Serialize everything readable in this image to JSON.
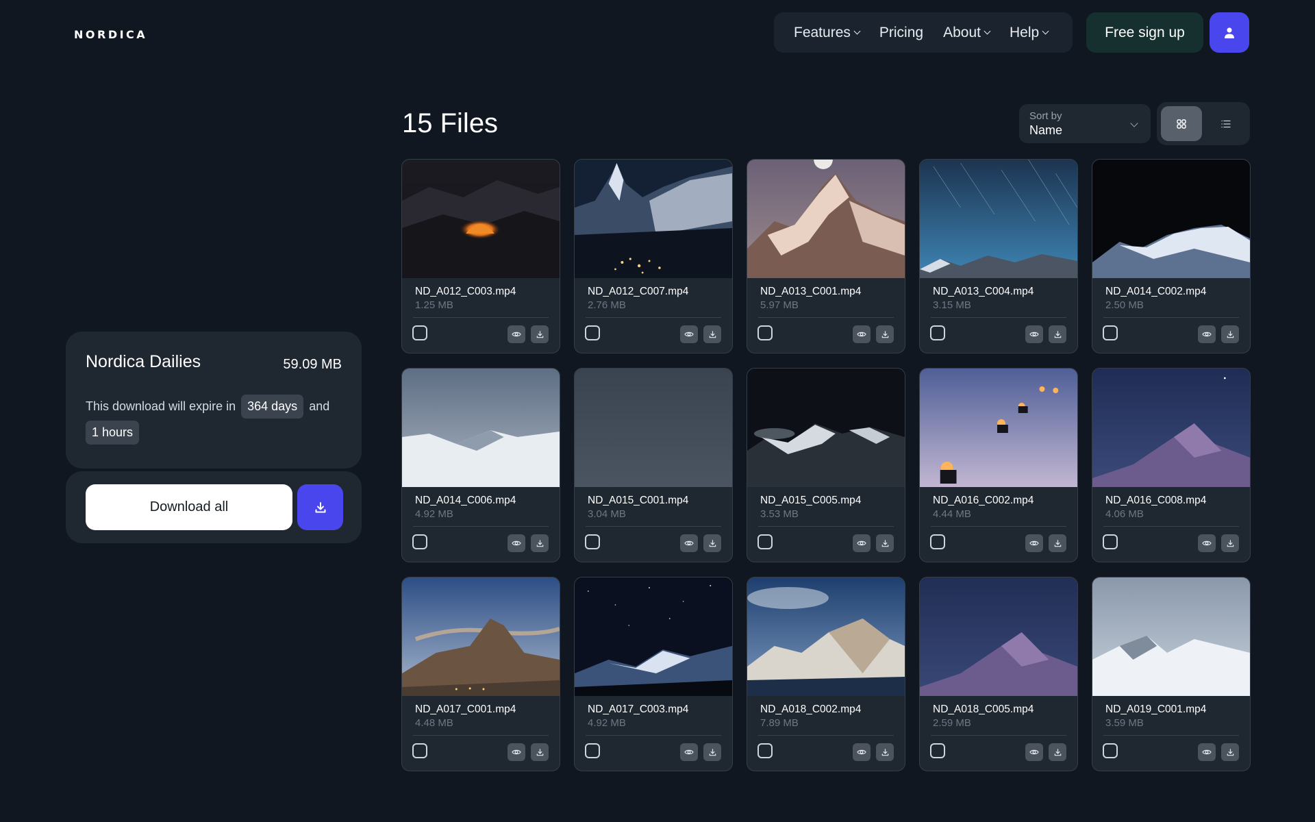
{
  "brand": {
    "logo": "NORDICA"
  },
  "nav": {
    "items": [
      {
        "label": "Features",
        "has_chevron": true
      },
      {
        "label": "Pricing",
        "has_chevron": false
      },
      {
        "label": "About",
        "has_chevron": true
      },
      {
        "label": "Help",
        "has_chevron": true
      }
    ],
    "signup_label": "Free sign up",
    "user_icon": "user-icon"
  },
  "panel": {
    "title": "Nordica Dailies",
    "total_size": "59.09 MB",
    "expire_prefix": "This download will expire in",
    "expire_days": "364 days",
    "expire_and": "and",
    "expire_hours": "1 hours",
    "download_all_label": "Download all",
    "download_icon": "download-icon"
  },
  "main": {
    "files_title": "15 Files",
    "sort": {
      "label": "Sort by",
      "value": "Name"
    },
    "view_modes": [
      "grid-icon",
      "list-icon"
    ],
    "active_view": "grid"
  },
  "colors": {
    "background": "#101720",
    "panel": "#1f2731",
    "accent": "#4a46ee",
    "signup_bg": "#15302f"
  },
  "files": [
    {
      "name": "ND_A012_C003.mp4",
      "size": "1.25 MB",
      "thumb": "orange tent at night in snowy mountains",
      "checked": false
    },
    {
      "name": "ND_A012_C007.mp4",
      "size": "2.76 MB",
      "thumb": "Matterhorn above night village",
      "checked": false
    },
    {
      "name": "ND_A013_C001.mp4",
      "size": "5.97 MB",
      "thumb": "rocky snow peak under moon",
      "checked": false
    },
    {
      "name": "ND_A013_C004.mp4",
      "size": "3.15 MB",
      "thumb": "star trails over mountain range",
      "checked": false
    },
    {
      "name": "ND_A014_C002.mp4",
      "size": "2.50 MB",
      "thumb": "snowy ridge under black sky",
      "checked": false
    },
    {
      "name": "ND_A014_C006.mp4",
      "size": "4.92 MB",
      "thumb": "snowy hills under grey sky",
      "checked": false
    },
    {
      "name": "ND_A015_C001.mp4",
      "size": "3.04 MB",
      "thumb": "flat grey overcast",
      "checked": false
    },
    {
      "name": "ND_A015_C005.mp4",
      "size": "3.53 MB",
      "thumb": "dark mountains with clouds",
      "checked": false
    },
    {
      "name": "ND_A016_C002.mp4",
      "size": "4.44 MB",
      "thumb": "snowmobiles with headlights",
      "checked": false
    },
    {
      "name": "ND_A016_C008.mp4",
      "size": "4.06 MB",
      "thumb": "blue dusk snow dune",
      "checked": false
    },
    {
      "name": "ND_A017_C001.mp4",
      "size": "4.48 MB",
      "thumb": "Matterhorn at dusk with lit town",
      "checked": false
    },
    {
      "name": "ND_A017_C003.mp4",
      "size": "4.92 MB",
      "thumb": "starry sky over snowy range",
      "checked": false
    },
    {
      "name": "ND_A018_C002.mp4",
      "size": "7.89 MB",
      "thumb": "snow peaks over fjord water",
      "checked": false
    },
    {
      "name": "ND_A018_C005.mp4",
      "size": "2.59 MB",
      "thumb": "blue dusk snow dune",
      "checked": false
    },
    {
      "name": "ND_A019_C001.mp4",
      "size": "3.59 MB",
      "thumb": "snowy hills under pale sky",
      "checked": false
    }
  ]
}
